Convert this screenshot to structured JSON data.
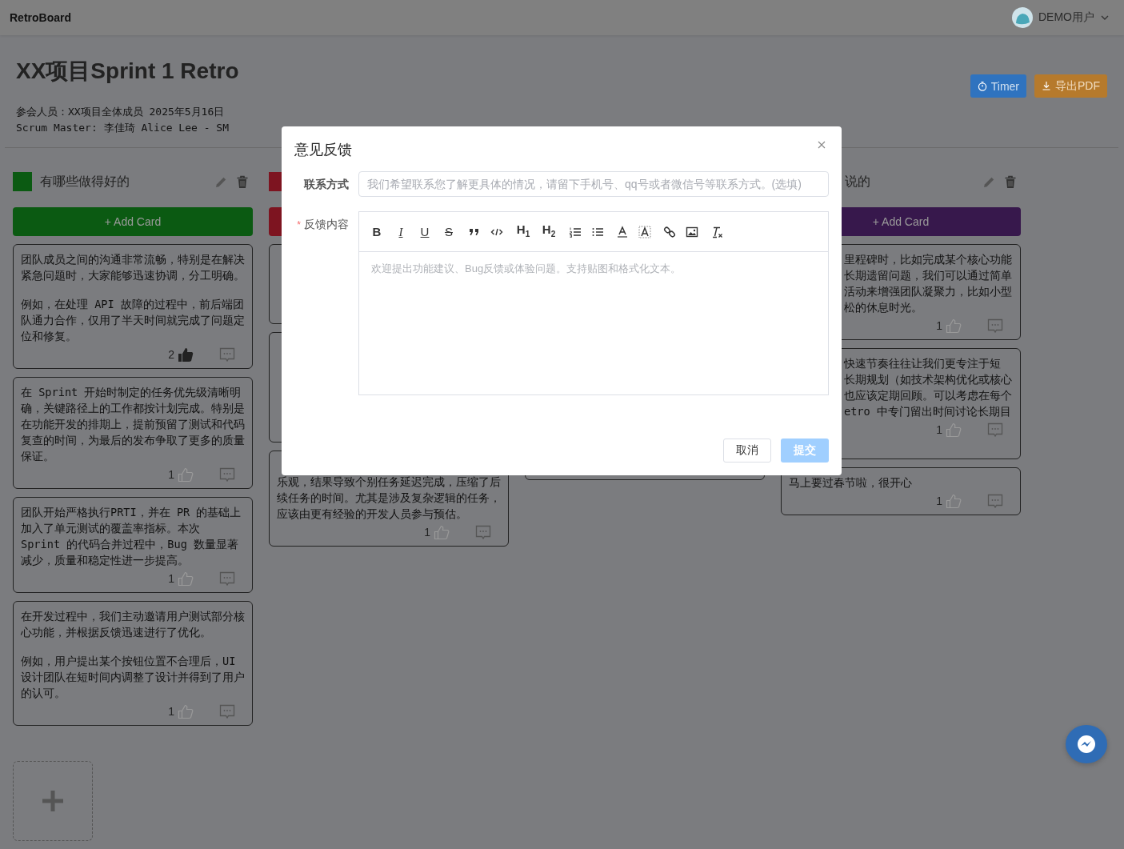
{
  "app": {
    "brand": "RetroBoard",
    "user": "DEMO用户"
  },
  "board": {
    "title": "XX项目Sprint 1 Retro",
    "info": [
      "参会人员：XX项目全体成员 2025年5月16日",
      "Scrum Master: 李佳琦 Alice Lee - SM"
    ],
    "actions": [
      {
        "kind": "timer",
        "label": "Timer"
      },
      {
        "kind": "export",
        "label": "导出PDF"
      }
    ]
  },
  "columns": [
    {
      "title": "有哪些做得好的",
      "color": "#0b5a12",
      "tools": true,
      "add_label": "+ Add Card",
      "cards": [
        {
          "kind": "text",
          "paragraphs": [
            "团队成员之间的沟通非常流畅，特别是在解决紧急问题时，大家能够迅速协调，分工明确。",
            "例如，在处理 API 故障的过程中，前后端团队通力合作，仅用了半天时间就完成了问题定位和修复。"
          ],
          "likes": "2",
          "liked": true
        },
        {
          "kind": "text",
          "paragraphs": [
            "在 Sprint 开始时制定的任务优先级清晰明确，关键路径上的工作都按计划完成。特别是在功能开发的排期上，提前预留了测试和代码复查的时间，为最后的发布争取了更多的质量保证。"
          ],
          "likes": "1",
          "liked": false
        },
        {
          "kind": "text",
          "paragraphs": [
            "团队开始严格执行PRTI，并在 PR 的基础上加入了单元测试的覆盖率指标。本次 Sprint 的代码合并过程中，Bug 数量显著减少，质量和稳定性进一步提高。"
          ],
          "likes": "1",
          "liked": false
        },
        {
          "kind": "text",
          "paragraphs": [
            "在开发过程中，我们主动邀请用户测试部分核心功能，并根据反馈迅速进行了优化。",
            "例如，用户提出某个按钮位置不合理后，UI 设计团队在短时间内调整了设计并得到了用户的认可。"
          ],
          "likes": "1",
          "liked": false
        }
      ]
    },
    {
      "color": "#7d1420",
      "cards": [
        {
          "kind": "covered"
        },
        {
          "kind": "covered"
        },
        {
          "kind": "tail",
          "paragraphs": [
            "乐观，结果导致个别任务延迟完成，压缩了后续任务的时间。尤其是涉及复杂逻辑的任务，应该由更有经验的开发人员参与预估。"
          ],
          "likes": "1",
          "liked": false
        }
      ]
    },
    {
      "cards": [
        {
          "kind": "covered"
        }
      ]
    },
    {
      "title": "说的",
      "title_clipped": true,
      "color": "#37184c",
      "tools": true,
      "add_label": "+ Add Card",
      "cards": [
        {
          "kind": "clipped",
          "lines": [
            "里程碑时，比如完成某个核心功能",
            "长期遗留问题，我们可以通过简单",
            "活动来增强团队凝聚力，比如小型",
            "松的休息时光。"
          ],
          "likes": "1",
          "liked": false
        },
        {
          "kind": "clipped",
          "lines": [
            "快速节奏往往让我们更专注于短",
            "长期规划（如技术架构优化或核心",
            "也应该定期回顾。可以考虑在每个",
            "etro 中专门留出时间讨论长期目"
          ],
          "likes": "1",
          "liked": false
        },
        {
          "kind": "text",
          "paragraphs": [
            "马上要过春节啦，很开心"
          ],
          "likes": "1",
          "liked": false
        }
      ]
    }
  ],
  "modal": {
    "title": "意见反馈",
    "contact_label": "联系方式",
    "contact_placeholder": "我们希望联系您了解更具体的情况，请留下手机号、qq号或者微信号等联系方式。(选填)",
    "content_label": "反馈内容",
    "required_mark": "*",
    "toolbar": [
      [
        {
          "kind": "bold",
          "label": "B"
        },
        {
          "kind": "italic",
          "label": "I"
        },
        {
          "kind": "underline",
          "label": "U"
        },
        {
          "kind": "strike",
          "label": "S"
        }
      ],
      [
        {
          "kind": "quote"
        },
        {
          "kind": "code"
        }
      ],
      [
        {
          "kind": "header",
          "label": "H$_{1}$"
        },
        {
          "kind": "header",
          "label": "H$_{2}$"
        }
      ],
      [
        {
          "kind": "ordered"
        },
        {
          "kind": "bullet"
        }
      ],
      [
        {
          "kind": "color"
        },
        {
          "kind": "background"
        }
      ],
      [
        {
          "kind": "link"
        },
        {
          "kind": "image"
        }
      ],
      [
        {
          "kind": "clean"
        }
      ]
    ],
    "content_placeholder": "欢迎提出功能建议、Bug反馈或体验问题。支持贴图和格式化文本。",
    "cancel": "取消",
    "submit": "提交",
    "submit_disabled": true
  }
}
